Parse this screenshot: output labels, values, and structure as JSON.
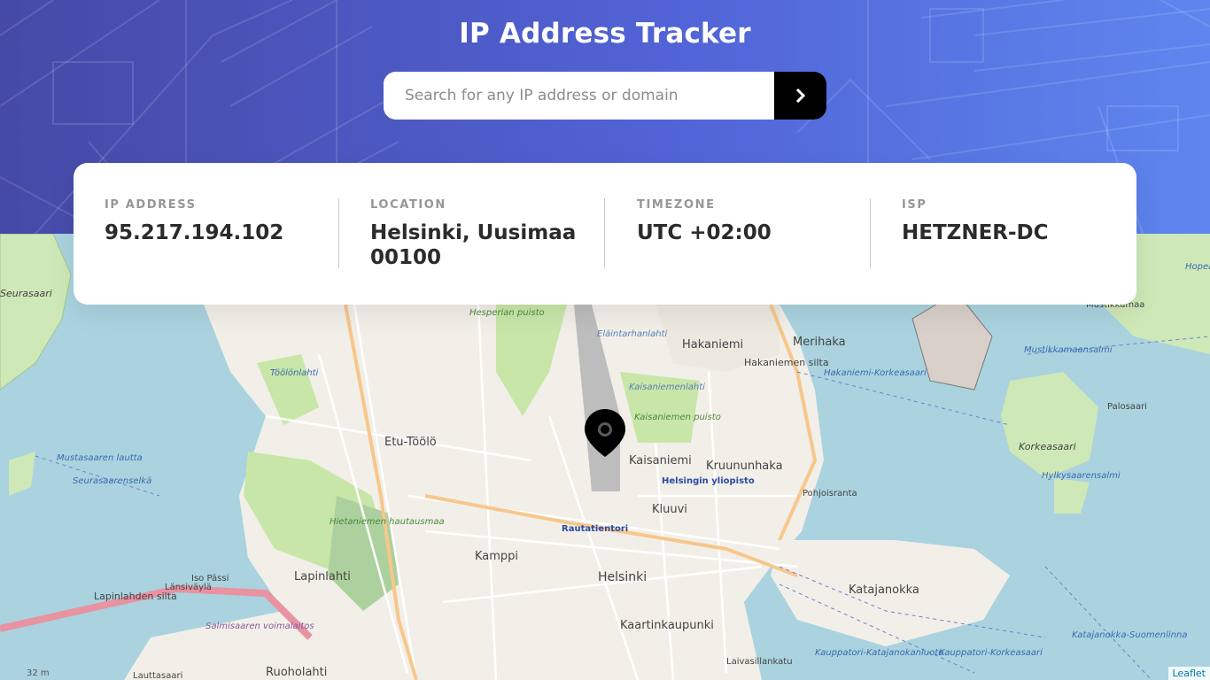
{
  "app": {
    "title": "IP Address Tracker"
  },
  "search": {
    "placeholder": "Search for any IP address or domain",
    "value": "",
    "button_icon": "chevron-right-icon"
  },
  "info": {
    "ip_address": {
      "label": "IP ADDRESS",
      "value": "95.217.194.102"
    },
    "location": {
      "label": "LOCATION",
      "value_line1": "Helsinki, Uusimaa",
      "value_line2": "00100"
    },
    "timezone": {
      "label": "TIMEZONE",
      "value": "UTC +02:00"
    },
    "isp": {
      "label": "ISP",
      "value": "HETZNER-DC"
    }
  },
  "map": {
    "marker_icon": "location-pin-icon",
    "attribution": "Leaflet",
    "scale_label": "32 m",
    "place_labels": [
      "Etu-Töölö",
      "Kaisaniemi",
      "Kruununhaka",
      "Hakaniemi",
      "Merihaka",
      "Hakaniemen silta",
      "Helsinki",
      "Kamppi",
      "Kluuvi",
      "Lapinlahti",
      "Katajanokka",
      "Kaartinkaupunki",
      "Ruoholahti",
      "Korkeasaari",
      "Palosaari",
      "Mustikkamaa",
      "Hesperian puisto",
      "Eläintarhanlahti",
      "Kaisaniemenlahti",
      "Kaisaniemen puisto",
      "Helsingin yliopisto",
      "Rautatientori",
      "Hietaniemen hautausmaa",
      "Lapinlahden silta",
      "Länsiväylä",
      "Salmisaaren voimalaitos",
      "Iso Pässi",
      "Mustasaaren lautta",
      "Seurasaarenselkä",
      "Hakaniemi-Korkeasaari",
      "Mustikkamaansalmi",
      "Hylkysaarensalmi",
      "Pohjoisranta",
      "Kauppatori-Korkeasaari",
      "Kauppatori-Katajanokanluoto",
      "Katajanokka-Suomenlinna",
      "Laivasillankatu",
      "Lauttasaari",
      "Seurasaari",
      "Hopea",
      "Töölönlahti"
    ]
  },
  "colors": {
    "header_start": "#4649a6",
    "header_end": "#5e86ee",
    "button": "#000000",
    "water": "#aad3df",
    "land": "#f2efe9",
    "park": "#c8e6a8"
  }
}
